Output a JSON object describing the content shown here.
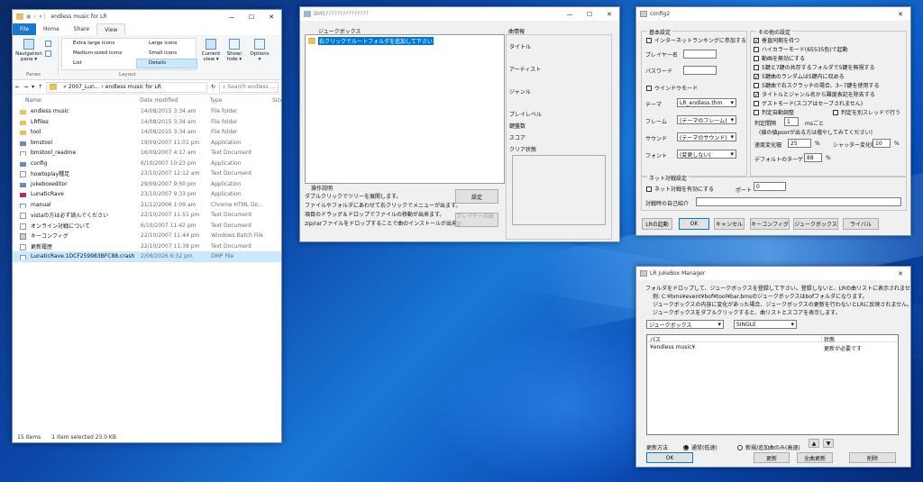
{
  "explorer": {
    "title": "endless music for LR",
    "tabs": [
      "File",
      "Home",
      "Share",
      "View"
    ],
    "ribbon": {
      "nav_pane": "Navigation\npane ▾",
      "panes": "Panes",
      "layout_items": [
        "Extra large icons",
        "Large icons",
        "Medium-sized icons",
        "Small icons",
        "List",
        "Details"
      ],
      "layout": "Layout",
      "current_view": "Current\nview ▾",
      "show_hide": "Show/\nhide ▾",
      "options": "Options\n▾"
    },
    "address": {
      "path": "«  2007_Lun...   ›   endless music for LR",
      "search_placeholder": "Search endless ..."
    },
    "columns": [
      "Name",
      "Date modified",
      "Type",
      "Size"
    ],
    "files": [
      {
        "name": "endless music",
        "date": "14/08/2015 3:34 am",
        "type": "File folder",
        "icon": "folder"
      },
      {
        "name": "LRfiles",
        "date": "14/08/2015 3:34 am",
        "type": "File folder",
        "icon": "folder"
      },
      {
        "name": "tool",
        "date": "14/08/2015 3:34 am",
        "type": "File folder",
        "icon": "folder"
      },
      {
        "name": "bmstool",
        "date": "19/09/2007 11:01 pm",
        "type": "Application",
        "icon": "app"
      },
      {
        "name": "bmstool_readme",
        "date": "16/09/2007 4:17 am",
        "type": "Text Document",
        "icon": "text"
      },
      {
        "name": "config",
        "date": "6/10/2007 10:23 pm",
        "type": "Application",
        "icon": "app"
      },
      {
        "name": "howtoplay種足",
        "date": "23/10/2007 12:12 am",
        "type": "Text Document",
        "icon": "text"
      },
      {
        "name": "jukeboxeditor",
        "date": "29/09/2007 9:50 pm",
        "type": "Application",
        "icon": "app"
      },
      {
        "name": "LunaticRave",
        "date": "23/10/2007 9:33 pm",
        "type": "Application",
        "icon": "app-red"
      },
      {
        "name": "manual",
        "date": "21/12/2006 1:09 am",
        "type": "Chrome HTML Do...",
        "icon": "html"
      },
      {
        "name": "vistaの方は必ず読んでください",
        "date": "22/10/2007 11:51 pm",
        "type": "Text Document",
        "icon": "text"
      },
      {
        "name": "オンライン対戦について",
        "date": "6/10/2007 11:42 pm",
        "type": "Text Document",
        "icon": "text"
      },
      {
        "name": "キーコンフィグ",
        "date": "22/10/2007 11:44 pm",
        "type": "Windows Batch File",
        "icon": "bat"
      },
      {
        "name": "更新履歴",
        "date": "22/10/2007 11:38 pm",
        "type": "Text Document",
        "icon": "text"
      },
      {
        "name": "LunaticRave.1DCF259983BFC88.crash",
        "date": "2/06/2026 6:32 pm",
        "type": "DMP File",
        "icon": "file"
      }
    ],
    "status": {
      "items": "15 items",
      "selected": "1 item selected  23.0 KB"
    }
  },
  "bms": {
    "title": "BMS???????????????",
    "jukebox_label": "ジュークボックス",
    "tree_item": "右クリックでルートフォルダを追加して下さい",
    "info_label": "曲情報",
    "info_fields": [
      "タイトル",
      "アーティスト",
      "ジャンル",
      "プレイレベル",
      "鍵盤数",
      "スコア",
      "クリア状態"
    ],
    "help_title": "操作説明",
    "help_lines": [
      "ダブルクリックでツリーを展開します。",
      "ファイルやフォルダにあわせて右クリックでメニューが出ます。",
      "項目のドラッグ＆ドロップでファイルの移動が出来ます。",
      "zip/rarファイルをドロップすることで曲のインストールが出来ます。"
    ],
    "settings_btn": "設定",
    "player_btn": "プレイヤーの設定"
  },
  "config": {
    "title": "config2",
    "basic": "基本設定",
    "ranking": "インターネットランキングに参加する",
    "player_name": "プレイヤー名",
    "password": "パスワード",
    "window_mode": "ウインドウモード",
    "theme_label": "テーマ",
    "theme_val": "LR_endless.thm",
    "frame_label": "フレーム",
    "frame_val": "(テーマのフレーム)",
    "sound_label": "サウンド",
    "sound_val": "(テーマのサウンド)",
    "font_label": "フォント",
    "font_val": "(変更しない)",
    "other": "その他の設定",
    "options": [
      {
        "text": "垂直同期を待つ",
        "on": true
      },
      {
        "text": "ハイカラーモード(65535色)で起動",
        "on": false
      },
      {
        "text": "動画を無効にする",
        "on": false
      },
      {
        "text": "5鍵と7鍵の共存するフォルダで5鍵を無視する",
        "on": false
      },
      {
        "text": "5鍵曲のランダムは5鍵内に収める",
        "on": true
      },
      {
        "text": "5鍵曲で右スクラッチの場合、3~7鍵を使用する",
        "on": false
      },
      {
        "text": "タイトルとジャンル名から難度表記を除去する",
        "on": true
      },
      {
        "text": "ゲストモード(スコアはセーブされません)",
        "on": false
      }
    ],
    "auto_adjust": "判定自動調整",
    "judge_thread": "判定を別スレッドで行う",
    "judge_interval": "判定間隔",
    "judge_val": "1",
    "ms": "msごと",
    "judge_note": "(値の値poorが出る方は増やしてみてください)",
    "speed_label": "速度変化幅",
    "speed_val": "25",
    "pct": "%",
    "shutter_label": "シャッター変化幅",
    "shutter_val": "10",
    "target_label": "デフォルトのターゲット",
    "target_val": "88",
    "net": "ネット対戦設定",
    "net_enable": "ネット対戦を有効にする",
    "port_label": "ポート",
    "port_val": "0",
    "intro_label": "対戦時の自己紹介",
    "buttons": [
      "LRの起動",
      "OK",
      "キャンセル",
      "キーコンフィグ",
      "ジュークボックス",
      "ライバル"
    ]
  },
  "jukebox": {
    "title": "LR JukeBox Manager",
    "lines": [
      "フォルダをドロップして、ジュークボックスを登録して下さい。登録しないと、LRの曲リストに表示されません。",
      "例: C:¥bms¥event¥bof¥tool¥bar.bmsのジュークボックスはbofフォルダになります。",
      "ジュークボックスの内容に変化があった場合、ジュークボックスの更新を行わないとLRに反映されません。",
      "ジュークボックスをダブルクリックすると、曲リストとスコアを表示します。"
    ],
    "combo1": "ジュークボックス",
    "combo2": "SINGLE",
    "col_path": "パス",
    "col_state": "状態",
    "row_path": "¥endless music¥",
    "row_state": "更新が必要です",
    "update_label": "更新方法",
    "radio1": "通常(低速)",
    "radio2": "新規/追加曲のみ(高速)",
    "ok": "OK",
    "update": "更新",
    "update_all": "全曲更新",
    "delete": "削除"
  }
}
